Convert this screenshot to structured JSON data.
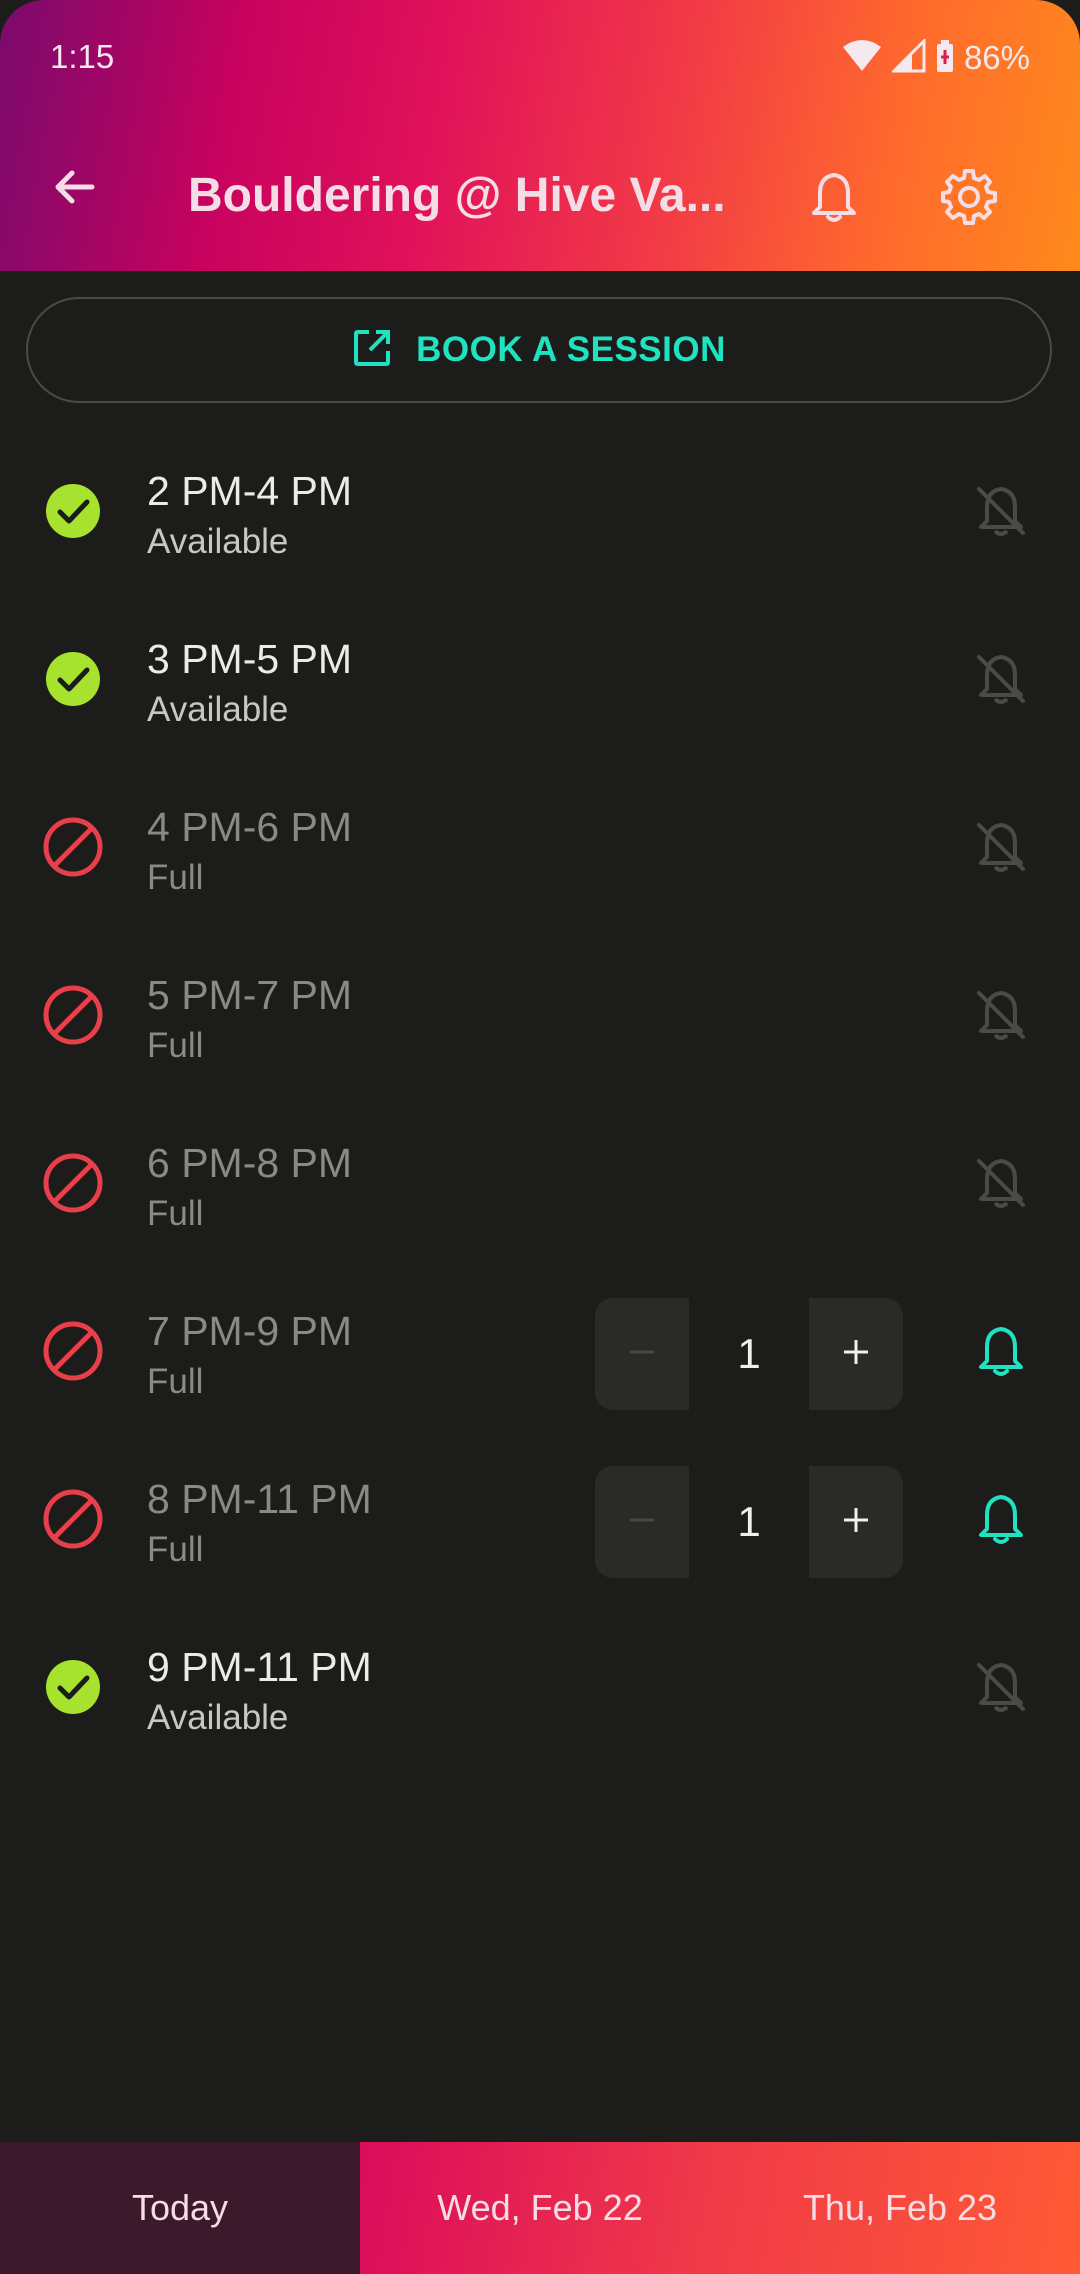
{
  "status_bar": {
    "time": "1:15",
    "battery": "86%"
  },
  "toolbar": {
    "title": "Bouldering @ Hive Va..."
  },
  "book_button": {
    "label": "BOOK A SESSION"
  },
  "slots": [
    {
      "time": "2 PM-4 PM",
      "status": "Available"
    },
    {
      "time": "3 PM-5 PM",
      "status": "Available"
    },
    {
      "time": "4 PM-6 PM",
      "status": "Full"
    },
    {
      "time": "5 PM-7 PM",
      "status": "Full"
    },
    {
      "time": "6 PM-8 PM",
      "status": "Full"
    },
    {
      "time": "7 PM-9 PM",
      "status": "Full",
      "count": "1"
    },
    {
      "time": "8 PM-11 PM",
      "status": "Full",
      "count": "1"
    },
    {
      "time": "9 PM-11 PM",
      "status": "Available"
    }
  ],
  "tabs": [
    "Today",
    "Wed, Feb 22",
    "Thu, Feb 23"
  ],
  "colors": {
    "accent": "#1fe3c0",
    "available": "#a6e22e",
    "full": "#e8404a",
    "background": "#1c1c1a"
  }
}
